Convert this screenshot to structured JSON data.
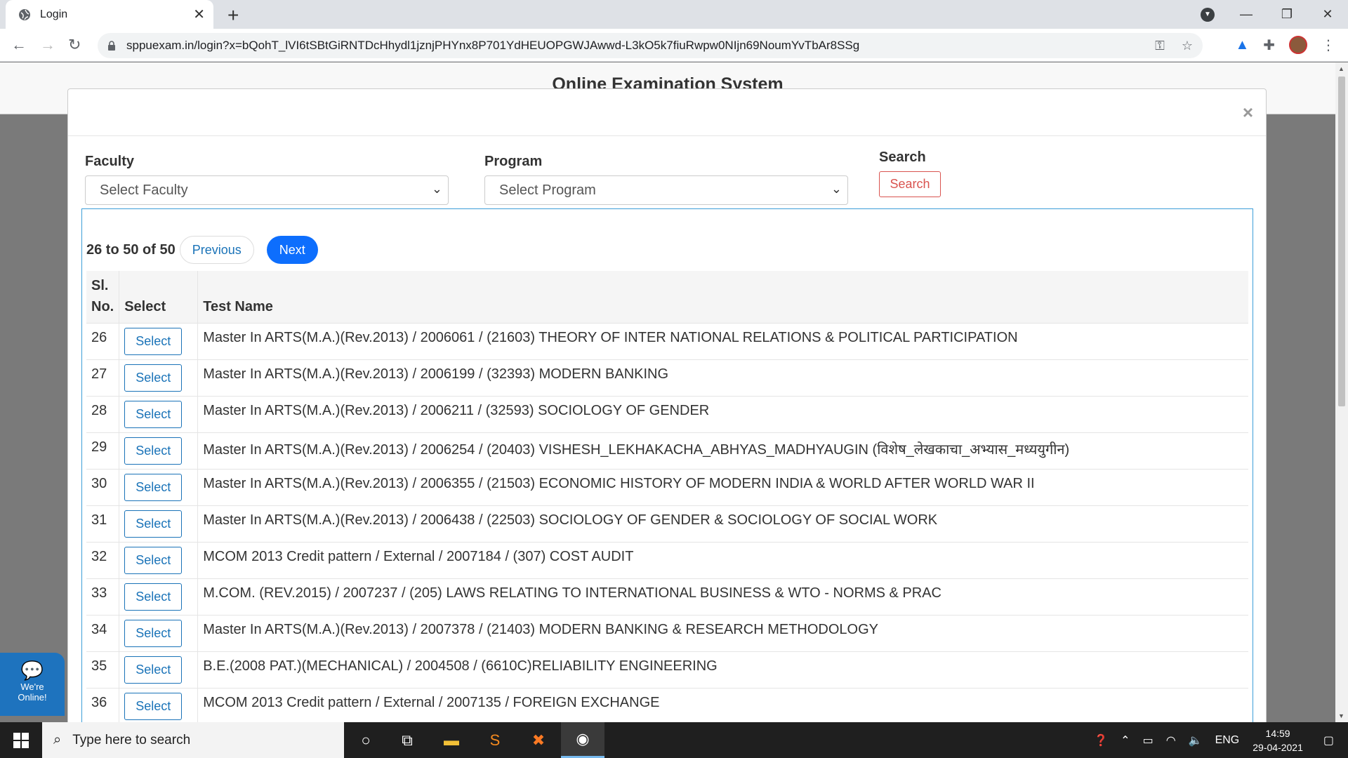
{
  "browser": {
    "tab_title": "Login",
    "url": "sppuexam.in/login?x=bQohT_lVI6tSBtGiRNTDcHhydl1jznjPHYnx8P701YdHEUOPGWJAwwd-L3kO5k7fiuRwpw0NIjn69NoumYvTbAr8SSg"
  },
  "page": {
    "title": "Online Examination System"
  },
  "modal": {
    "close": "×",
    "faculty_label": "Faculty",
    "faculty_value": "Select Faculty",
    "program_label": "Program",
    "program_value": "Select Program",
    "search_label": "Search",
    "search_button": "Search",
    "pager_info": "26 to 50 of 50",
    "prev_label": "Previous",
    "next_label": "Next",
    "col_no_line1": "Sl.",
    "col_no_line2": "No.",
    "col_select": "Select",
    "col_name": "Test Name",
    "rows": [
      {
        "no": "26",
        "btn": "Select",
        "name": "Master In ARTS(M.A.)(Rev.2013) / 2006061 / (21603) THEORY OF INTER NATIONAL RELATIONS & POLITICAL PARTICIPATION"
      },
      {
        "no": "27",
        "btn": "Select",
        "name": "Master In ARTS(M.A.)(Rev.2013) / 2006199 / (32393) MODERN BANKING"
      },
      {
        "no": "28",
        "btn": "Select",
        "name": "Master In ARTS(M.A.)(Rev.2013) / 2006211 / (32593) SOCIOLOGY OF GENDER"
      },
      {
        "no": "29",
        "btn": "Select",
        "name": "Master In ARTS(M.A.)(Rev.2013) / 2006254 / (20403) VISHESH_LEKHAKACHA_ABHYAS_MADHYAUGIN (विशेष_लेखकाचा_अभ्यास_मध्ययुगीन)"
      },
      {
        "no": "30",
        "btn": "Select",
        "name": "Master In ARTS(M.A.)(Rev.2013) / 2006355 / (21503) ECONOMIC HISTORY OF MODERN INDIA & WORLD AFTER WORLD WAR II"
      },
      {
        "no": "31",
        "btn": "Select",
        "name": "Master In ARTS(M.A.)(Rev.2013) / 2006438 / (22503) SOCIOLOGY OF GENDER & SOCIOLOGY OF SOCIAL WORK"
      },
      {
        "no": "32",
        "btn": "Select",
        "name": "MCOM 2013 Credit pattern / External / 2007184 / (307) COST AUDIT"
      },
      {
        "no": "33",
        "btn": "Select",
        "name": "M.COM. (REV.2015) / 2007237 / (205) LAWS RELATING TO INTERNATIONAL BUSINESS & WTO - NORMS & PRAC"
      },
      {
        "no": "34",
        "btn": "Select",
        "name": "Master In ARTS(M.A.)(Rev.2013) / 2007378 / (21403) MODERN BANKING & RESEARCH METHODOLOGY"
      },
      {
        "no": "35",
        "btn": "Select",
        "name": "B.E.(2008 PAT.)(MECHANICAL) / 2004508 / (6610C)RELIABILITY ENGINEERING"
      },
      {
        "no": "36",
        "btn": "Select",
        "name": "MCOM 2013 Credit pattern / External / 2007135 / FOREIGN EXCHANGE"
      }
    ]
  },
  "chat": {
    "line1": "We're",
    "line2": "Online!"
  },
  "taskbar": {
    "search_placeholder": "Type here to search",
    "lang": "ENG",
    "time": "14:59",
    "date": "29-04-2021"
  }
}
